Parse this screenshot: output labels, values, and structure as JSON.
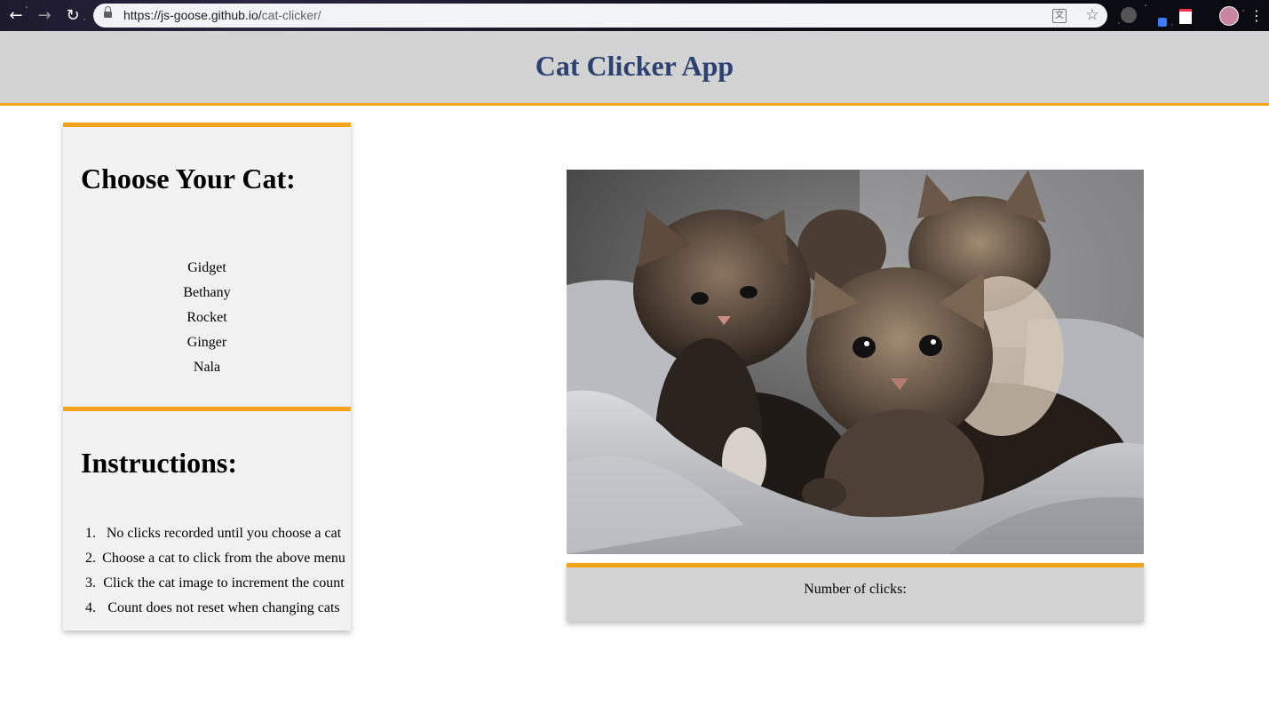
{
  "browser": {
    "url_host": "https://js-goose.github.io/",
    "url_path": "cat-clicker/"
  },
  "header": {
    "title": "Cat Clicker App"
  },
  "cat_menu": {
    "heading": "Choose Your Cat:",
    "cats": [
      "Gidget",
      "Bethany",
      "Rocket",
      "Ginger",
      "Nala"
    ]
  },
  "instructions": {
    "heading": "Instructions:",
    "items": [
      {
        "num": "1.",
        "text": "No clicks recorded until you choose a cat"
      },
      {
        "num": "2.",
        "text": "Choose a cat to click from the above menu"
      },
      {
        "num": "3.",
        "text": "Click the cat image to increment the count"
      },
      {
        "num": "4.",
        "text": "Count does not reset when changing cats"
      }
    ]
  },
  "counter": {
    "label": "Number of clicks:"
  },
  "colors": {
    "accent": "#f5a31a",
    "header_bg": "#d3d3d3",
    "title": "#2c4270",
    "card_bg": "#f2f2f2"
  },
  "icons": {
    "back": "back-arrow-icon",
    "forward": "forward-arrow-icon",
    "reload": "reload-icon",
    "lock": "lock-icon",
    "translate": "translate-icon",
    "bookmark": "star-icon",
    "menu": "more-vert-icon"
  }
}
